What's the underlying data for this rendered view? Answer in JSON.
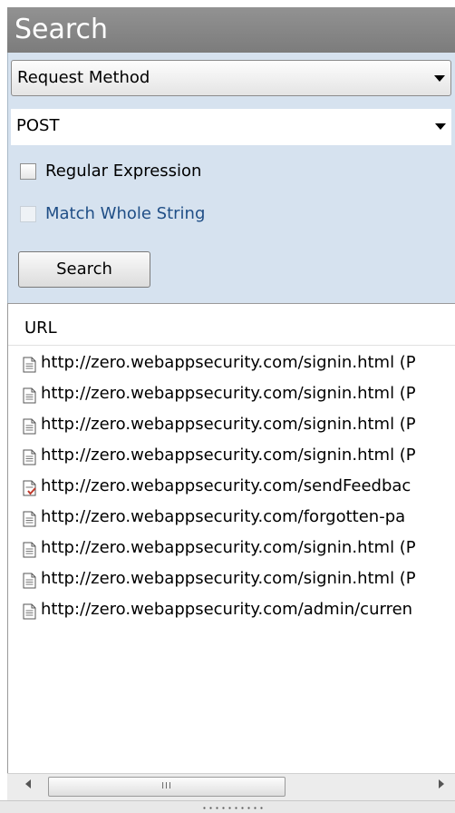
{
  "header": {
    "title": "Search"
  },
  "search_form": {
    "field_select": {
      "selected": "Request Method"
    },
    "value_select": {
      "selected": "POST"
    },
    "regex_checkbox": {
      "label": "Regular Expression",
      "checked": false
    },
    "whole_string_checkbox": {
      "label": "Match Whole String",
      "checked": false,
      "enabled": false
    },
    "search_button": {
      "label": "Search"
    }
  },
  "results": {
    "column_header": "URL",
    "rows": [
      {
        "url": "http://zero.webappsecurity.com/signin.html (P",
        "icon": "page-icon"
      },
      {
        "url": "http://zero.webappsecurity.com/signin.html (P",
        "icon": "page-icon"
      },
      {
        "url": "http://zero.webappsecurity.com/signin.html (P",
        "icon": "page-icon"
      },
      {
        "url": "http://zero.webappsecurity.com/signin.html (P",
        "icon": "page-icon"
      },
      {
        "url": "http://zero.webappsecurity.com/sendFeedbac",
        "icon": "page-check-icon"
      },
      {
        "url": "http://zero.webappsecurity.com/forgotten-pa",
        "icon": "page-icon"
      },
      {
        "url": "http://zero.webappsecurity.com/signin.html (P",
        "icon": "page-icon"
      },
      {
        "url": "http://zero.webappsecurity.com/signin.html (P",
        "icon": "page-icon"
      },
      {
        "url": "http://zero.webappsecurity.com/admin/curren",
        "icon": "page-icon"
      }
    ]
  },
  "scrollbar": {
    "thumb_grip": "III"
  },
  "colors": {
    "header_bg": "#8a8a8a",
    "form_bg": "#d6e2ef",
    "disabled_label": "#1f4e86",
    "check_mark": "#c0392b"
  }
}
